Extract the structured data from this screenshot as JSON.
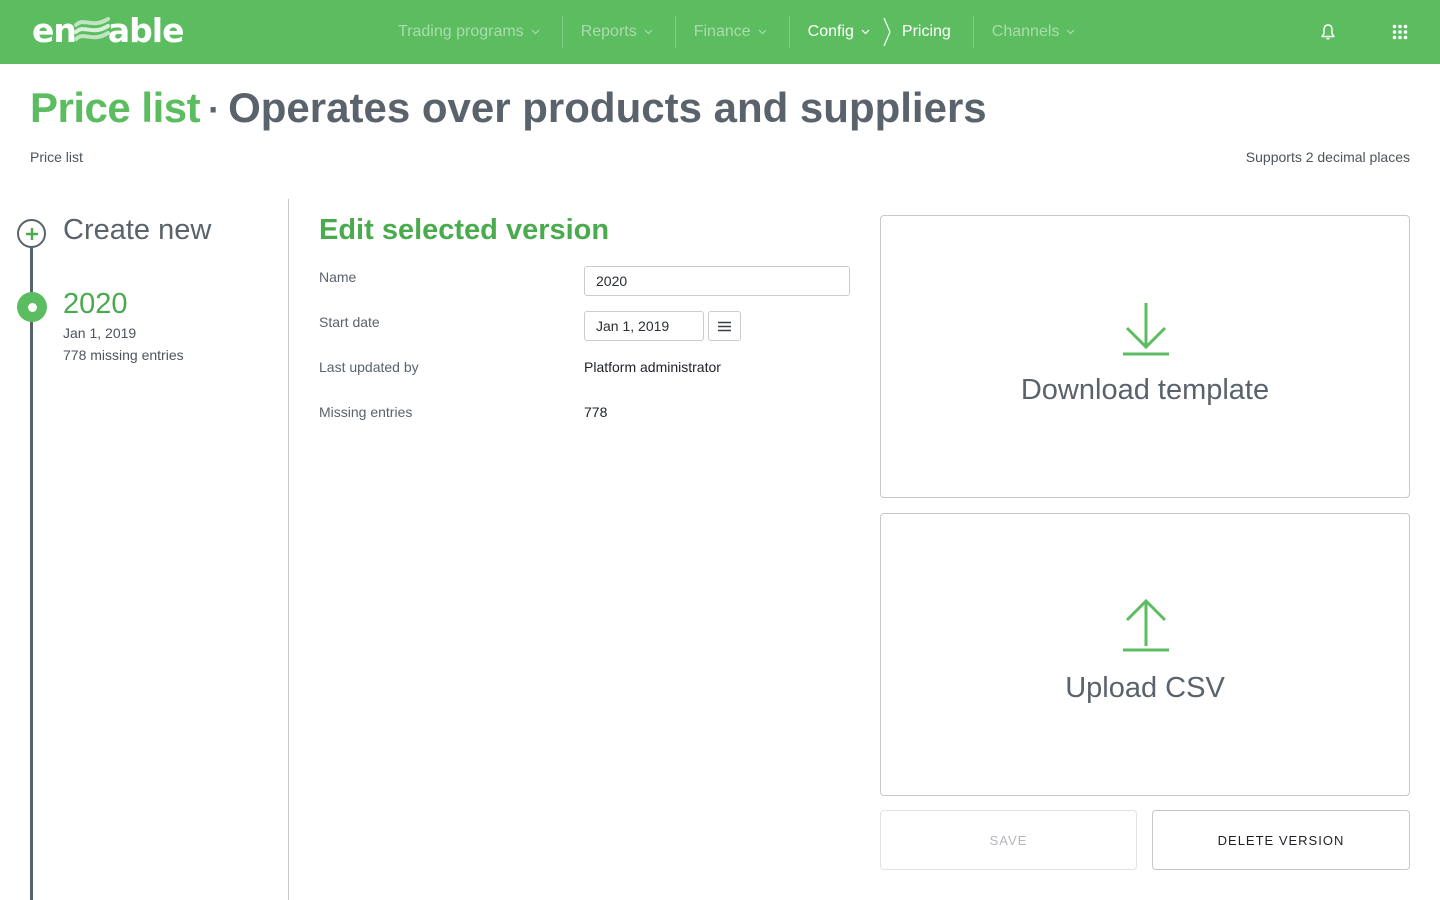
{
  "colors": {
    "brand": "#5cbd60",
    "accent_text": "#4aaa4e",
    "text": "#5a626b",
    "nav_inactive": "#a9dcab"
  },
  "topbar": {
    "logo_left": "en",
    "logo_right": "able",
    "nav": [
      {
        "label": "Trading programs",
        "icon": "chevron-down-icon"
      },
      {
        "label": "Reports",
        "icon": "chevron-down-icon"
      },
      {
        "label": "Finance",
        "icon": "chevron-down-icon"
      },
      {
        "label": "Config",
        "icon": "chevron-down-icon",
        "active": true
      },
      {
        "label": "Channels",
        "icon": "chevron-down-icon"
      }
    ],
    "current_page": "Pricing",
    "icons": [
      "bell-icon",
      "apps-grid-icon"
    ]
  },
  "header": {
    "title": "Price list",
    "separator": "·",
    "subtitle": "Operates over products and suppliers",
    "breadcrumb": "Price list",
    "precision_note": "Supports 2 decimal places"
  },
  "timeline": {
    "create_label": "Create new",
    "versions": [
      {
        "name": "2020",
        "date": "Jan 1, 2019",
        "missing": "778 missing entries",
        "selected": true
      }
    ]
  },
  "form": {
    "title": "Edit selected version",
    "name_label": "Name",
    "name_value": "2020",
    "start_date_label": "Start date",
    "start_date_value": "Jan 1, 2019",
    "last_updated_label": "Last updated by",
    "last_updated_value": "Platform administrator",
    "missing_label": "Missing entries",
    "missing_value": "778"
  },
  "actions": {
    "download_label": "Download template",
    "upload_label": "Upload CSV",
    "save_label": "SAVE",
    "delete_label": "DELETE VERSION"
  }
}
